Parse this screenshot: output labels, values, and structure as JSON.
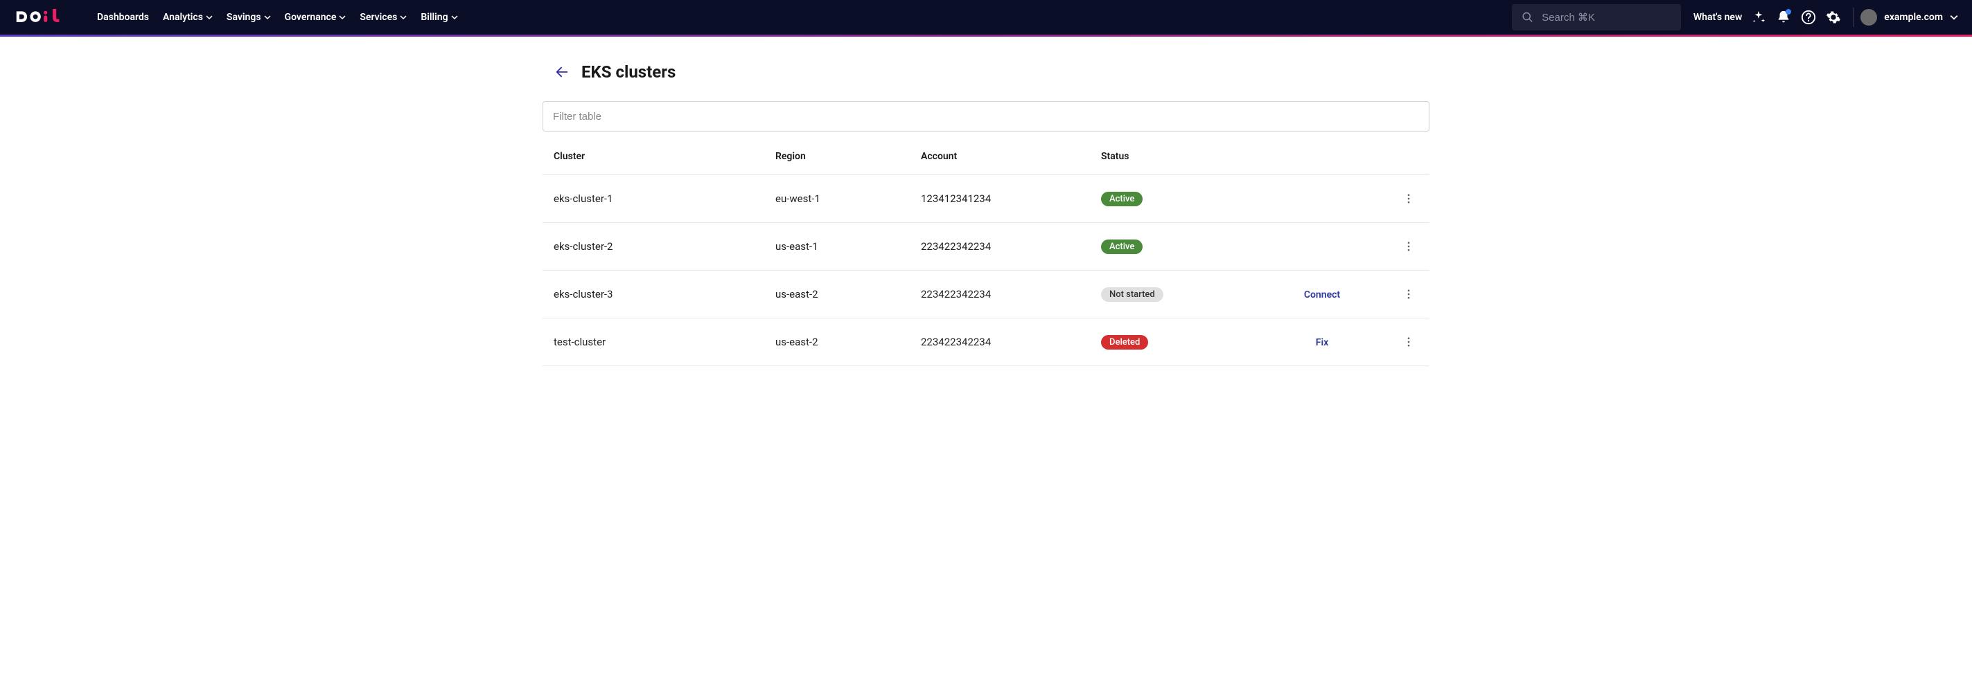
{
  "nav": {
    "items": [
      {
        "label": "Dashboards",
        "dropdown": false
      },
      {
        "label": "Analytics",
        "dropdown": true
      },
      {
        "label": "Savings",
        "dropdown": true
      },
      {
        "label": "Governance",
        "dropdown": true
      },
      {
        "label": "Services",
        "dropdown": true
      },
      {
        "label": "Billing",
        "dropdown": true
      }
    ]
  },
  "search": {
    "placeholder": "Search ⌘K"
  },
  "whats_new": "What's new",
  "account": {
    "domain": "example.com"
  },
  "page": {
    "title": "EKS clusters",
    "filter_placeholder": "Filter table"
  },
  "table": {
    "headers": {
      "cluster": "Cluster",
      "region": "Region",
      "account": "Account",
      "status": "Status"
    },
    "rows": [
      {
        "cluster": "eks-cluster-1",
        "region": "eu-west-1",
        "account": "123412341234",
        "status": "Active",
        "status_class": "active",
        "action": ""
      },
      {
        "cluster": "eks-cluster-2",
        "region": "us-east-1",
        "account": "223422342234",
        "status": "Active",
        "status_class": "active",
        "action": ""
      },
      {
        "cluster": "eks-cluster-3",
        "region": "us-east-2",
        "account": "223422342234",
        "status": "Not started",
        "status_class": "notstarted",
        "action": "Connect"
      },
      {
        "cluster": "test-cluster",
        "region": "us-east-2",
        "account": "223422342234",
        "status": "Deleted",
        "status_class": "deleted",
        "action": "Fix"
      }
    ]
  }
}
